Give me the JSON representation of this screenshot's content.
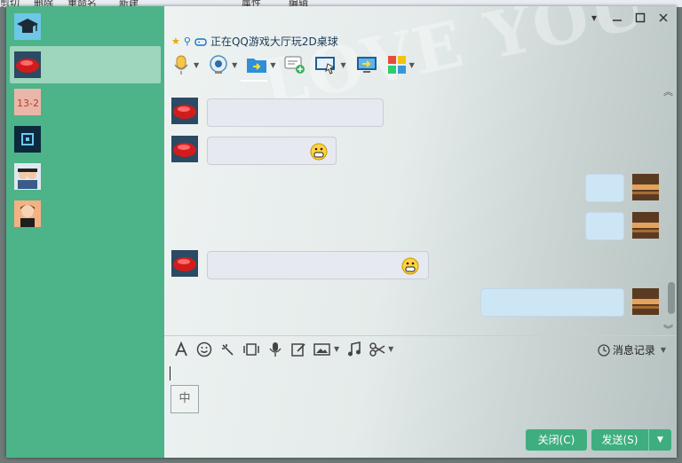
{
  "background_window": {
    "menu_items": [
      "剪切",
      "删除",
      "重命名",
      "新建",
      "属性",
      "编辑"
    ]
  },
  "title_bar": {
    "status_text": "正在QQ游戏大厅玩2D桌球",
    "controls": [
      "chevron-down-icon",
      "minimize-icon",
      "maximize-icon",
      "close-icon"
    ]
  },
  "toolbar": {
    "items": [
      "microphone-icon",
      "webcam-icon",
      "send-file-icon",
      "new-chat-icon",
      "remote-desktop-icon",
      "share-screen-icon",
      "apps-icon"
    ]
  },
  "input_toolbar": {
    "items": [
      "font-icon",
      "emoji-icon",
      "shake-icon",
      "screenshot-icon",
      "voice-icon",
      "edit-icon",
      "image-icon",
      "music-icon",
      "scissors-icon"
    ],
    "history_label": "消息记录"
  },
  "input": {
    "ime_indicator": "中"
  },
  "buttons": {
    "close_label": "关闭(C)",
    "send_label": "发送(S)"
  },
  "colors": {
    "sidebar": "#4db388",
    "button": "#3fae7f",
    "bubble_incoming": "#e6e9ef",
    "bubble_outgoing": "#cde6f5"
  }
}
